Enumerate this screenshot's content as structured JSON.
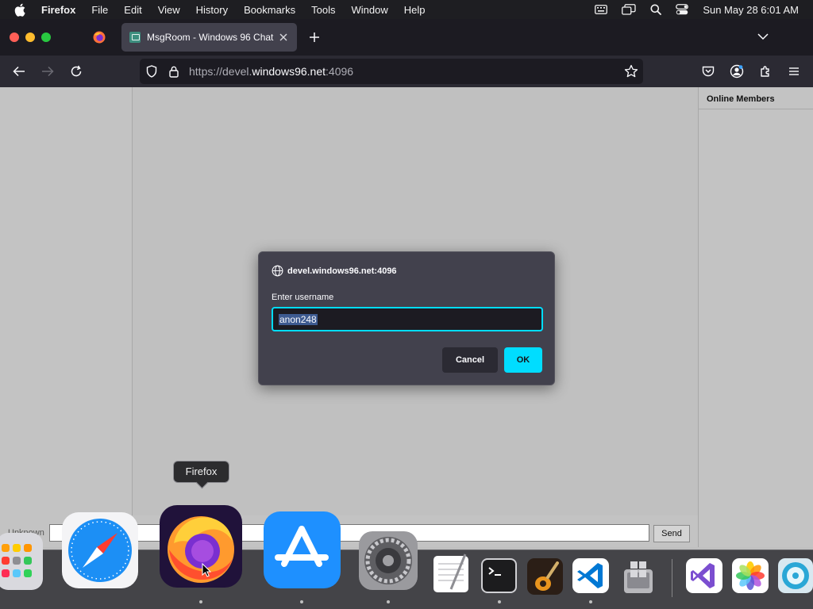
{
  "menubar": {
    "items": [
      "Firefox",
      "File",
      "Edit",
      "View",
      "History",
      "Bookmarks",
      "Tools",
      "Window",
      "Help"
    ],
    "clock": "Sun May 28  6:01 AM"
  },
  "tab": {
    "title": "MsgRoom - Windows 96 Chat"
  },
  "urlbar": {
    "scheme": "https://devel.",
    "host": "windows96.net",
    "port": ":4096"
  },
  "page": {
    "online_members_title": "Online Members",
    "user_label": "Unknown",
    "send_label": "Send"
  },
  "dialog": {
    "origin": "devel.windows96.net:4096",
    "prompt": "Enter username",
    "value": "anon248",
    "cancel_label": "Cancel",
    "ok_label": "OK"
  },
  "tooltip": {
    "text": "Firefox"
  },
  "colors": {
    "accent": "#00ddff",
    "toolbar": "#2b2a33",
    "dialog_bg": "#42414d",
    "page_bg": "#c0c0c0"
  },
  "icons": {
    "menubar": [
      "apple-icon",
      "keyboard-icon",
      "screen-mirroring-icon",
      "spotlight-search-icon",
      "control-center-icon"
    ],
    "nav": [
      "back-icon",
      "forward-icon",
      "reload-icon",
      "shield-icon",
      "lock-icon",
      "bookmark-star-icon",
      "pocket-icon",
      "account-icon",
      "extensions-icon",
      "menu-icon"
    ],
    "dock": [
      "launchpad-icon",
      "safari-icon",
      "firefox-icon",
      "app-store-icon",
      "system-settings-icon",
      "textedit-icon",
      "terminal-icon",
      "garageband-icon",
      "vscode-icon",
      "boot-camp-icon",
      "visual-studio-icon",
      "photos-icon",
      "disk-utility-icon"
    ]
  }
}
